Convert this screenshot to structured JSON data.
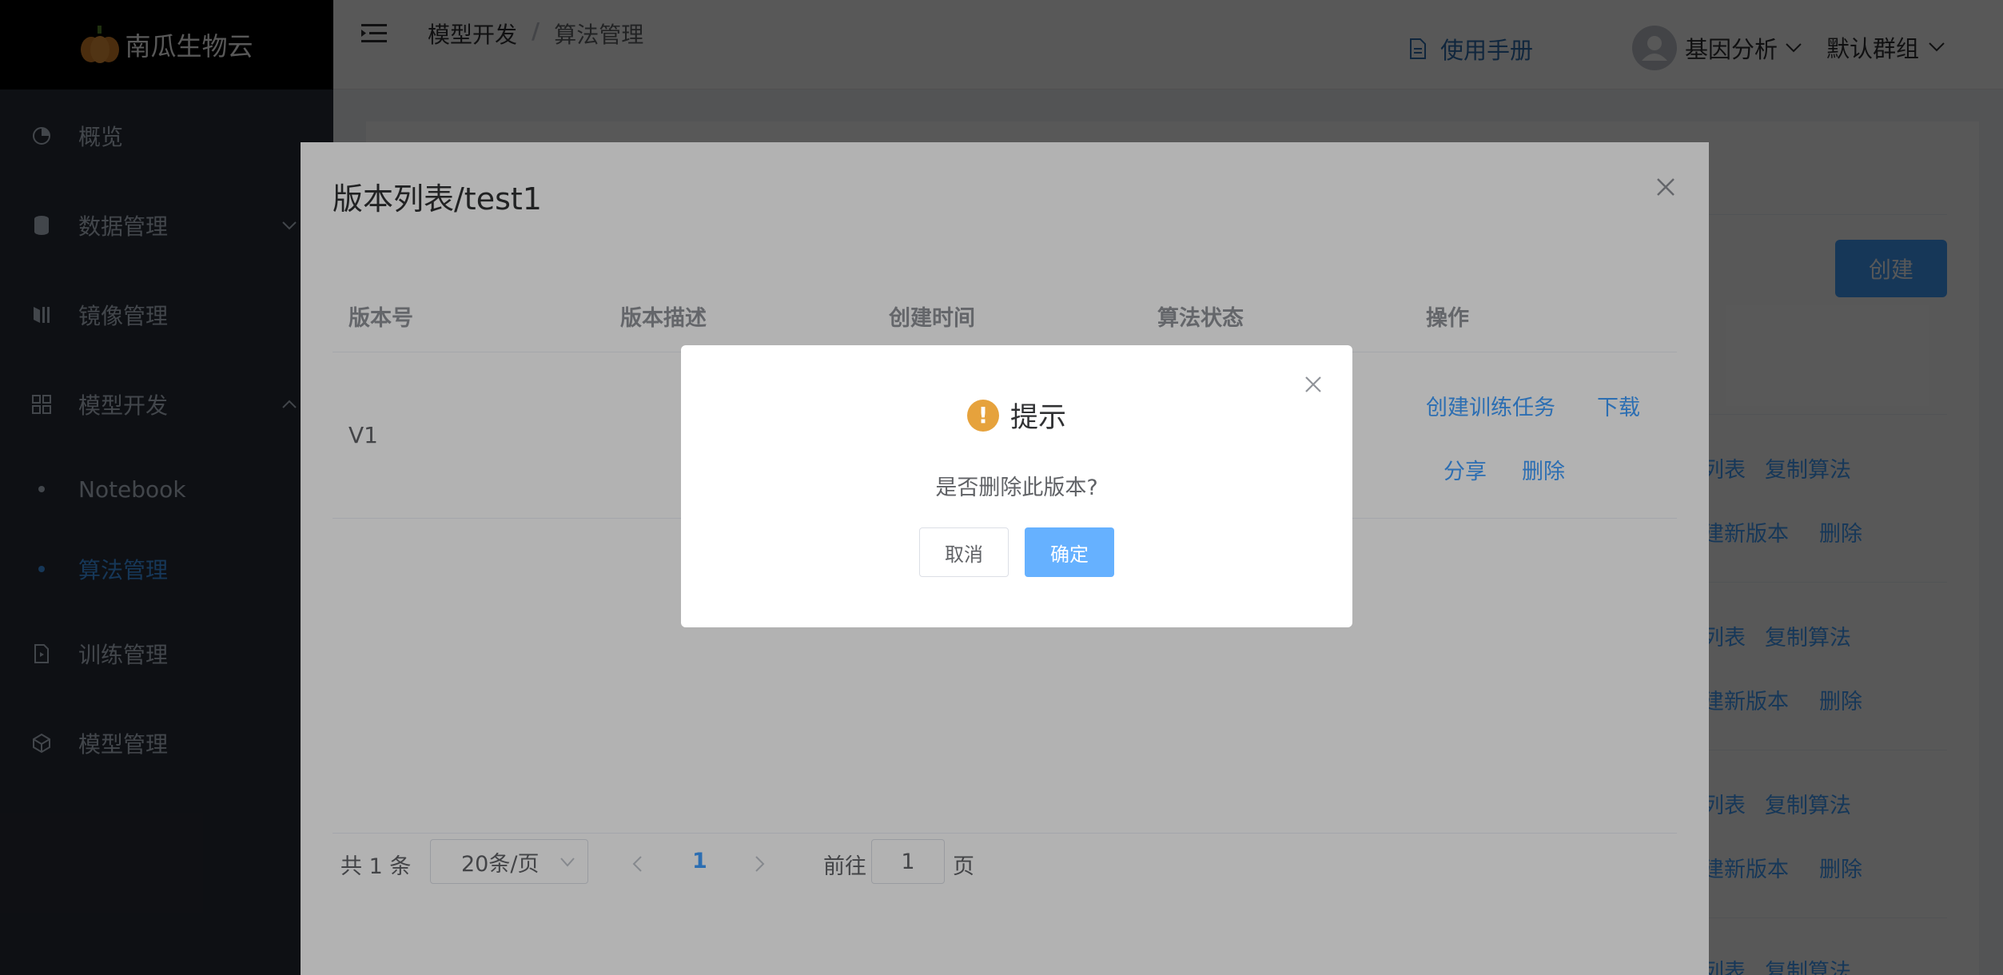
{
  "brand": {
    "name": "南瓜生物云",
    "logo_icon": "pumpkin-icon"
  },
  "sidebar": {
    "items": [
      {
        "label": "概览",
        "icon": "dashboard-icon"
      },
      {
        "label": "数据管理",
        "icon": "database-icon"
      },
      {
        "label": "镜像管理",
        "icon": "mirror-icon"
      },
      {
        "label": "模型开发",
        "icon": "grid-icon"
      },
      {
        "label": "Notebook"
      },
      {
        "label": "算法管理"
      },
      {
        "label": "训练管理",
        "icon": "document-icon"
      },
      {
        "label": "模型管理",
        "icon": "cube-icon"
      }
    ],
    "active_index": 5
  },
  "header": {
    "breadcrumb": [
      "模型开发",
      "算法管理"
    ],
    "breadcrumb_separator": "/",
    "manual_label": "使用手册",
    "user_name": "基因分析",
    "group_name": "默认群组"
  },
  "background": {
    "create_label": "创建",
    "row_links": [
      {
        "a": "列表",
        "b": "复制算法",
        "c": "建新版本",
        "d": "删除"
      },
      {
        "a": "列表",
        "b": "复制算法",
        "c": "建新版本",
        "d": "删除"
      },
      {
        "a": "列表",
        "b": "复制算法",
        "c": "建新版本",
        "d": "删除"
      },
      {
        "a": "列表",
        "b": "复制算法"
      }
    ]
  },
  "dialog": {
    "title": "版本列表/test1",
    "columns": [
      "版本号",
      "版本描述",
      "创建时间",
      "算法状态",
      "操作"
    ],
    "rows": [
      {
        "version": "V1",
        "actions": [
          "创建训练任务",
          "下载",
          "分享",
          "删除"
        ]
      }
    ],
    "pagination": {
      "total_label": "共 1 条",
      "page_size": "20条/页",
      "current_page": "1",
      "goto_prefix": "前往",
      "goto_value": "1",
      "goto_suffix": "页"
    }
  },
  "confirm": {
    "title": "提示",
    "message": "是否删除此版本?",
    "cancel_label": "取消",
    "ok_label": "确定",
    "warn_glyph": "!"
  },
  "colors": {
    "primary": "#409eff",
    "warning": "#e6a23c",
    "sidebar": "#2b2f3a"
  }
}
